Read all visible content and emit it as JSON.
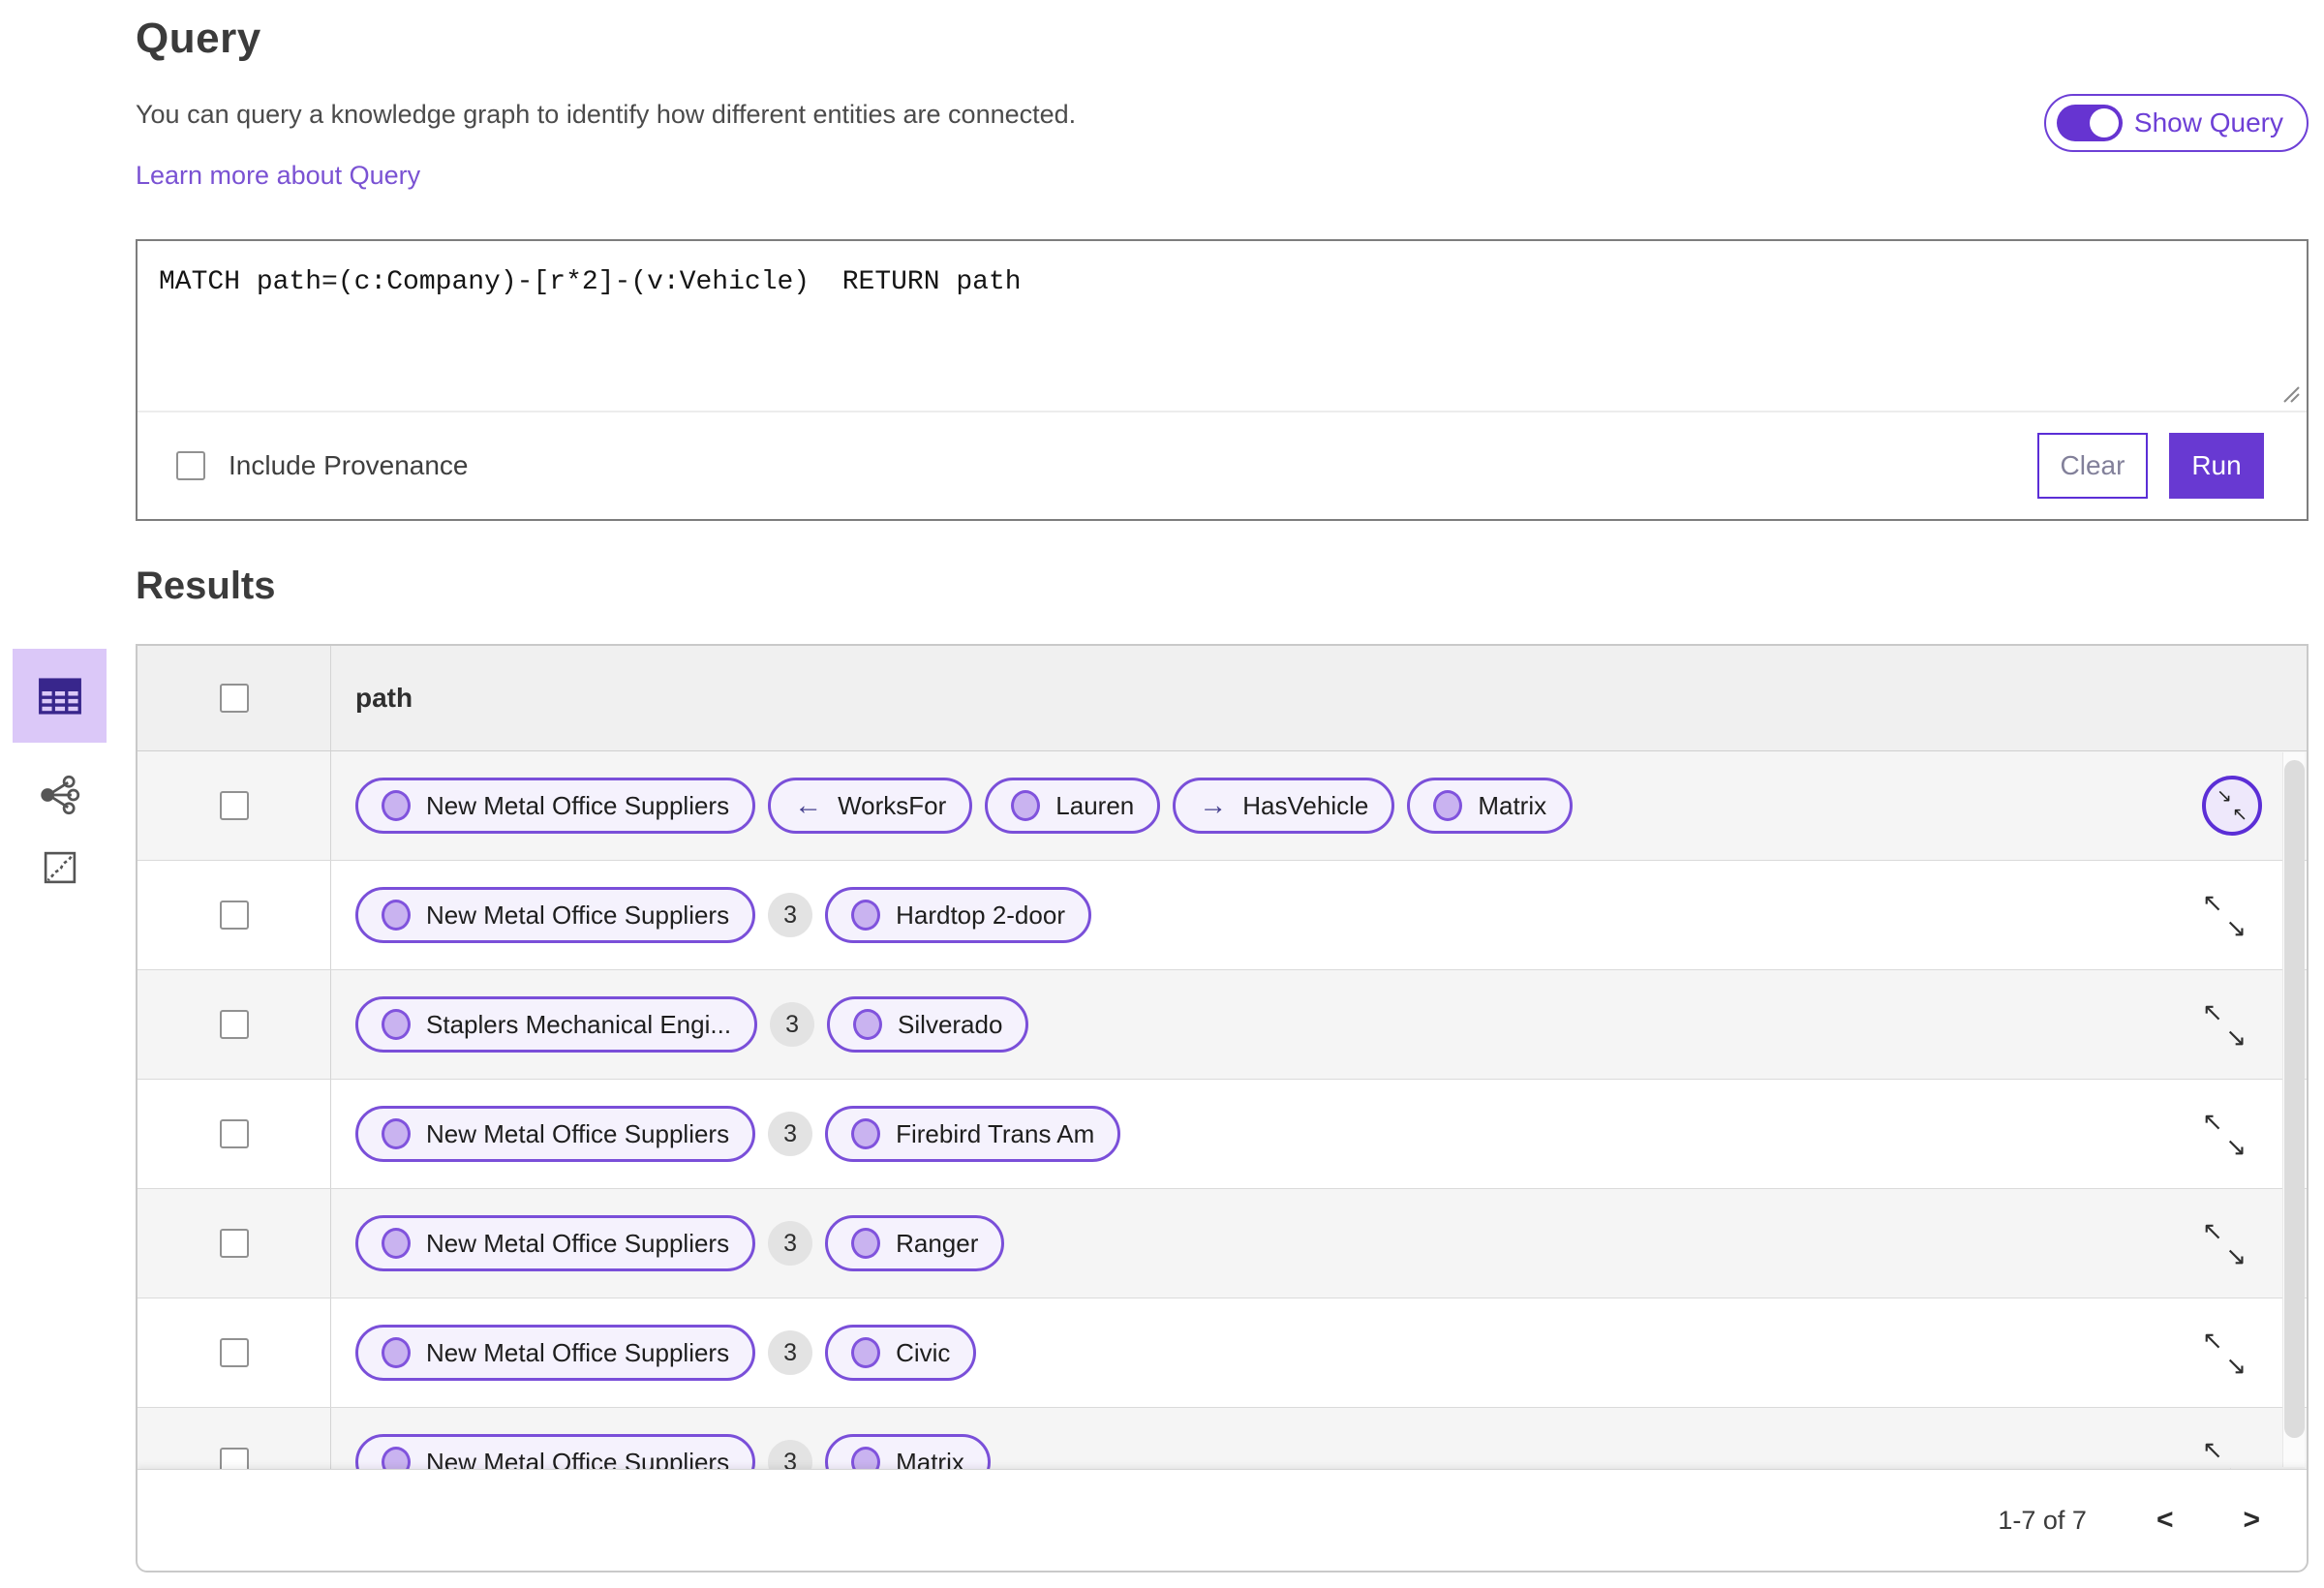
{
  "colors": {
    "primary_purple": "#6839d2",
    "toggle_purple": "#6634d1",
    "pill_border": "#7a4fd9",
    "pill_background": "#f5f2fd",
    "node_dot_fill": "#c9b3f0",
    "link_purple": "#7a52d3",
    "selected_view_background": "#dbc8f8",
    "header_row_background": "#f0f0f0",
    "zebra_row_background": "#f5f5f5"
  },
  "query_section": {
    "title": "Query",
    "description": "You can query a knowledge graph to identify how different entities are connected.",
    "learn_more_label": "Learn more about Query",
    "show_query_label": "Show Query",
    "query_text": "MATCH path=(c:Company)-[r*2]-(v:Vehicle)  RETURN path",
    "include_provenance_label": "Include Provenance",
    "clear_label": "Clear",
    "run_label": "Run"
  },
  "results_section": {
    "title": "Results",
    "path_column_header": "path",
    "view_switcher": [
      "table-view",
      "graph-view",
      "map-view"
    ],
    "rows": [
      {
        "expanded": true,
        "segments": [
          {
            "type": "node",
            "label": "New Metal Office Suppliers"
          },
          {
            "type": "edge",
            "dir": "left",
            "label": "WorksFor"
          },
          {
            "type": "node",
            "label": "Lauren"
          },
          {
            "type": "edge",
            "dir": "right",
            "label": "HasVehicle"
          },
          {
            "type": "node",
            "label": "Matrix"
          }
        ]
      },
      {
        "expanded": false,
        "segments": [
          {
            "type": "node",
            "label": "New Metal Office Suppliers"
          },
          {
            "type": "count",
            "label": "3"
          },
          {
            "type": "node",
            "label": "Hardtop 2-door"
          }
        ]
      },
      {
        "expanded": false,
        "segments": [
          {
            "type": "node",
            "label": "Staplers Mechanical Engi..."
          },
          {
            "type": "count",
            "label": "3"
          },
          {
            "type": "node",
            "label": "Silverado"
          }
        ]
      },
      {
        "expanded": false,
        "segments": [
          {
            "type": "node",
            "label": "New Metal Office Suppliers"
          },
          {
            "type": "count",
            "label": "3"
          },
          {
            "type": "node",
            "label": "Firebird Trans Am"
          }
        ]
      },
      {
        "expanded": false,
        "segments": [
          {
            "type": "node",
            "label": "New Metal Office Suppliers"
          },
          {
            "type": "count",
            "label": "3"
          },
          {
            "type": "node",
            "label": "Ranger"
          }
        ]
      },
      {
        "expanded": false,
        "segments": [
          {
            "type": "node",
            "label": "New Metal Office Suppliers"
          },
          {
            "type": "count",
            "label": "3"
          },
          {
            "type": "node",
            "label": "Civic"
          }
        ]
      },
      {
        "expanded": false,
        "segments": [
          {
            "type": "node",
            "label": "New Metal Office Suppliers"
          },
          {
            "type": "count",
            "label": "3"
          },
          {
            "type": "node",
            "label": "Matrix"
          }
        ]
      }
    ],
    "pagination": {
      "range_label": "1-7 of 7",
      "prev_icon": "<",
      "next_icon": ">"
    }
  }
}
